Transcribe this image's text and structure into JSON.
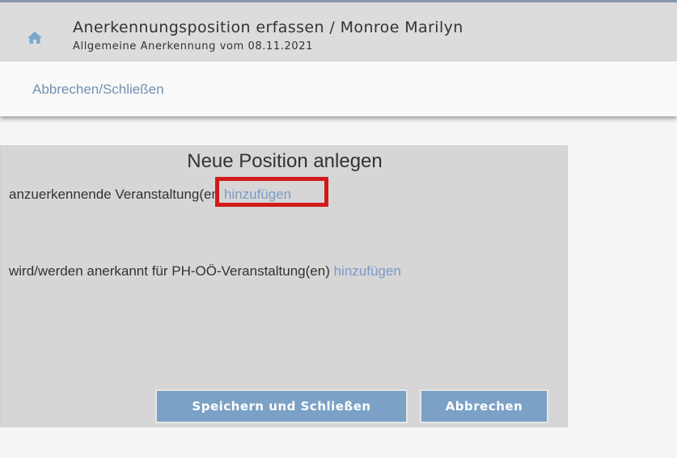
{
  "header": {
    "title": "Anerkennungsposition erfassen  / Monroe Marilyn",
    "subtitle": "Allgemeine Anerkennung vom 08.11.2021",
    "home_icon": "home-icon"
  },
  "toolbar": {
    "cancel_close_label": "Abbrechen/Schließen"
  },
  "panel": {
    "title": "Neue Position anlegen",
    "row1_text": "anzuerkennende Veranstaltung(en",
    "row1_link": "hinzufügen",
    "row2_text": "wird/werden anerkannt für PH-OÖ-Veranstaltung(en)",
    "row2_link": "hinzufügen",
    "save_button": "Speichern und Schließen",
    "cancel_button": "Abbrechen"
  },
  "colors": {
    "link": "#7a9ac8",
    "button": "#7ba1c6",
    "highlight": "#d11a1a",
    "header_bg": "#dcdcdc",
    "panel_bg": "#d6d6d6"
  }
}
